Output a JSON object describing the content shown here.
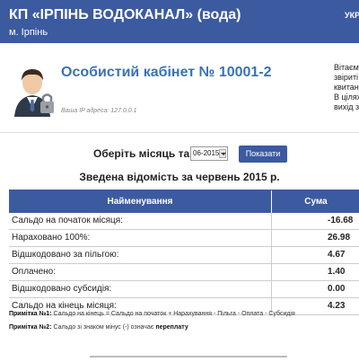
{
  "header": {
    "org_title": "КП «ІРПІНЬ ВОДОКАНАЛ» (вода)",
    "city": "м. Ірпінь",
    "lang": "УКР"
  },
  "profile": {
    "avatar_icon": "user-lock-icon",
    "cabinet_title": "Особистий кабінет № 10001-2",
    "ip_label": "Ваша IP адреса:",
    "ip_value": "127.0.0.1"
  },
  "welcome_lines": [
    "Вітаєм",
    "звіриті",
    "квитан",
    "В цілях",
    "вихід з"
  ],
  "filter": {
    "label": "Оберіть місяць та рік",
    "selected": "06-2015",
    "button": "Показати"
  },
  "summary": {
    "title": "Зведена відомість за червень 2015 р.",
    "columns": [
      "Найменування",
      "Сума"
    ],
    "rows": [
      {
        "name": "Сальдо на початок місяця:",
        "value": "-16.68"
      },
      {
        "name": "Нараховано 100%:",
        "value": "26.98"
      },
      {
        "name": "Відшкодовано за пільгою:",
        "value": "4.67"
      },
      {
        "name": "Оплачено:",
        "value": "1.40"
      },
      {
        "name": "Відшкодовано субсидія:",
        "value": "0.00"
      },
      {
        "name": "Сальдо на кінець місяця:",
        "value": "4.23"
      }
    ]
  },
  "notes": {
    "n1_label": "Примітка №1:",
    "n1_text": " Сальдо на кінець = Сальдо на початок + Нарахування - Пільга - Оплата - Субсидія",
    "n2_label": "Примітка №2:",
    "n2_text": " Сальдо зі знаком мінус (-) означає ",
    "n2_emphasis": "переплату"
  },
  "colors": {
    "header_bg": "#3b5aa0",
    "title_blue": "#3a72b4"
  }
}
